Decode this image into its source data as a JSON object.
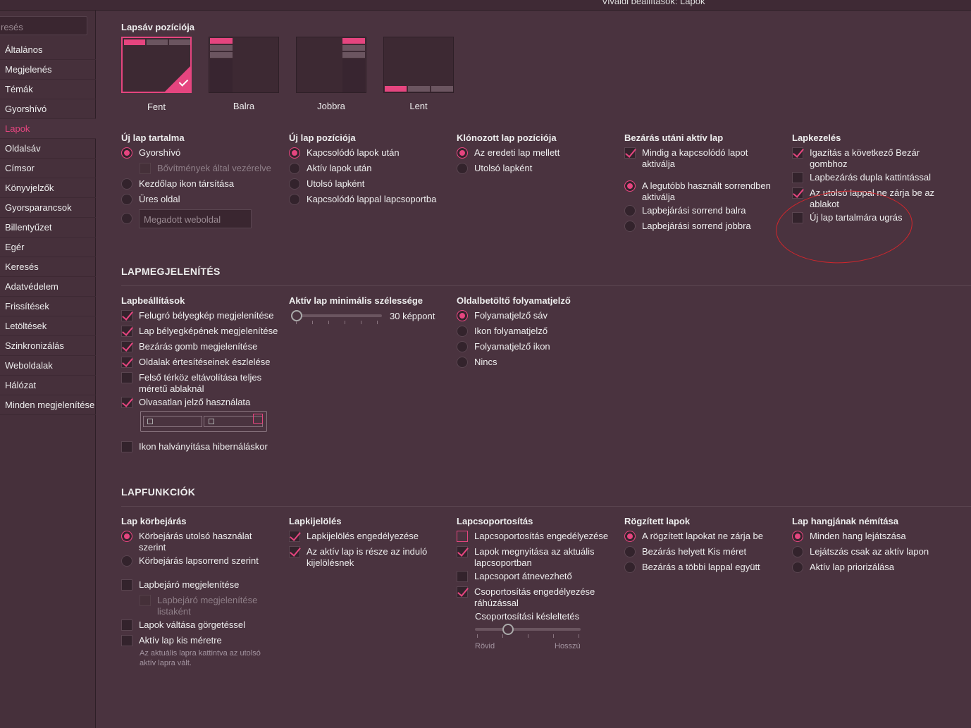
{
  "window": {
    "title": "Vivaldi beállítások: Lapok"
  },
  "sidebar": {
    "search_placeholder": "resés",
    "items": [
      "Általános",
      "Megjelenés",
      "Témák",
      "Gyorshívó",
      "Lapok",
      "Oldalsáv",
      "Címsor",
      "Könyvjelzők",
      "Gyorsparancsok",
      "Billentyűzet",
      "Egér",
      "Keresés",
      "Adatvédelem",
      "Frissítések",
      "Letöltések",
      "Szinkronizálás",
      "Weboldalak",
      "Hálózat",
      "Minden megjelenítése"
    ],
    "active_index": 4
  },
  "tab_position": {
    "heading": "Lapsáv pozíciója",
    "options": [
      "Fent",
      "Balra",
      "Jobbra",
      "Lent"
    ],
    "selected": "Fent"
  },
  "new_tab_content": {
    "heading": "Új lap tartalma",
    "options": [
      "Gyorshívó",
      "Bővítmények által vezérelve",
      "Kezdőlap ikon társítása",
      "Üres oldal"
    ],
    "custom_placeholder": "Megadott weboldal"
  },
  "new_tab_position": {
    "heading": "Új lap pozíciója",
    "options": [
      "Kapcsolódó lapok után",
      "Aktív lapok után",
      "Utolsó lapként",
      "Kapcsolódó lappal lapcsoportba"
    ]
  },
  "cloned_tab_position": {
    "heading": "Klónozott lap pozíciója",
    "options": [
      "Az eredeti lap mellett",
      "Utolsó lapként"
    ]
  },
  "after_close": {
    "heading": "Bezárás utáni aktív lap",
    "options": [
      "Mindig a kapcsolódó lapot aktiválja",
      "A legutóbb használt sorrendben aktiválja",
      "Lapbejárási sorrend balra",
      "Lapbejárási sorrend jobbra"
    ]
  },
  "tab_handling": {
    "heading": "Lapkezelés",
    "options": [
      "Igazítás a következő Bezár gombhoz",
      "Lapbezárás dupla kattintással",
      "Az utolsó lappal ne zárja be az ablakot",
      "Új lap tartalmára ugrás"
    ]
  },
  "tab_display": {
    "section": "LAPMEGJELENÍTÉS"
  },
  "tab_settings": {
    "heading": "Lapbeállítások",
    "options": [
      "Felugró bélyegkép megjelenítése",
      "Lap bélyegképének megjelenítése",
      "Bezárás gomb megjelenítése",
      "Oldalak értesítéseinek észlelése",
      "Felső térköz eltávolítása teljes méretű ablaknál",
      "Olvasatlan jelző használata",
      "Ikon halványítása hibernáláskor"
    ]
  },
  "min_width": {
    "heading": "Aktív lap minimális szélessége",
    "value_label": "30 képpont",
    "value_fraction": 0.0
  },
  "progress": {
    "heading": "Oldalbetöltő folyamatjelző",
    "options": [
      "Folyamatjelző sáv",
      "Ikon folyamatjelző",
      "Folyamatjelző ikon",
      "Nincs"
    ]
  },
  "tab_features": {
    "section": "LAPFUNKCIÓK"
  },
  "cycling": {
    "heading": "Lap körbejárás",
    "options": [
      "Körbejárás utolsó használat szerint",
      "Körbejárás lapsorrend szerint",
      "Lapbejáró megjelenítése",
      "Lapbejáró megjelenítése listaként",
      "Lapok váltása görgetéssel",
      "Aktív lap kis méretre"
    ],
    "hint": "Az aktuális lapra kattintva az utolsó aktív lapra vált."
  },
  "selection": {
    "heading": "Lapkijelölés",
    "options": [
      "Lapkijelölés engedélyezése",
      "Az aktív lap is része az induló kijelölésnek"
    ]
  },
  "grouping": {
    "heading": "Lapcsoportosítás",
    "options": [
      "Lapcsoportosítás engedélyezése",
      "Lapok megnyitása az aktuális lapcsoportban",
      "Lapcsoport átnevezhető",
      "Csoportosítás engedélyezése ráhúzással"
    ],
    "delay_label": "Csoportosítási késleltetés",
    "delay_min": "Rövid",
    "delay_max": "Hosszú",
    "delay_fraction": 0.28
  },
  "pinned": {
    "heading": "Rögzített lapok",
    "options": [
      "A rögzített lapokat ne zárja be",
      "Bezárás helyett Kis méret",
      "Bezárás a többi lappal együtt"
    ]
  },
  "mute": {
    "heading": "Lap hangjának némítása",
    "options": [
      "Minden hang lejátszása",
      "Lejátszás csak az aktív lapon",
      "Aktív lap priorizálása"
    ]
  },
  "colors": {
    "accent": "#e5457f",
    "bg": "#4a333f",
    "annotation": "#d1262c"
  }
}
